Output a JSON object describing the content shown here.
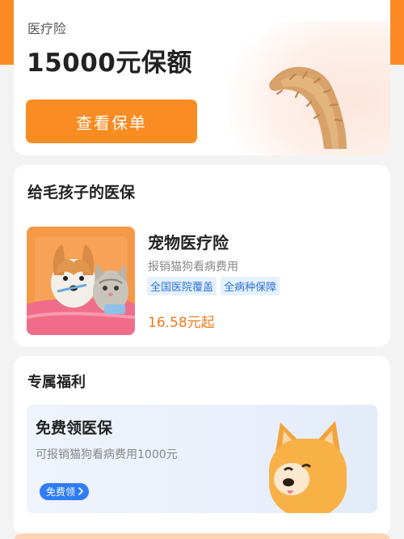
{
  "insurance_card": {
    "type_label": "医疗险",
    "coverage_amount": "15000元保额",
    "view_button": "查看保单"
  },
  "pet_section": {
    "title": "给毛孩子的医保",
    "product": {
      "name": "宠物医疗险",
      "description": "报销猫狗看病费用",
      "tags": [
        "全国医院覆盖",
        "全病种保障"
      ],
      "price": "16.58元起"
    }
  },
  "benefits": {
    "title": "专属福利",
    "offer": {
      "title": "免费领医保",
      "description": "可报销猫狗看病费用1000元",
      "button": "免费领"
    }
  },
  "colors": {
    "brand_orange": "#f98c22",
    "price_orange": "#f07a1a",
    "tag_blue": "#2c74d6",
    "button_blue": "#2f7cf6"
  }
}
